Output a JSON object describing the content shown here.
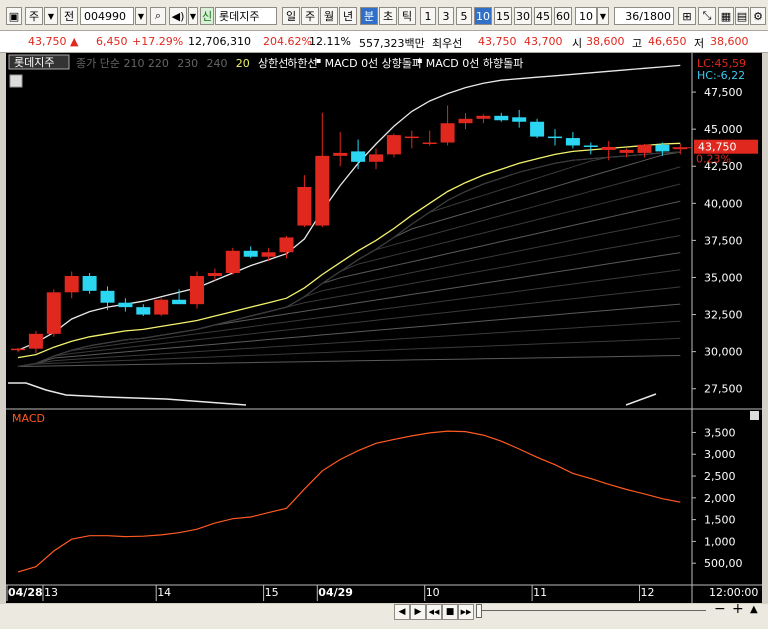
{
  "toolbar": {
    "market": "주",
    "market_arrow": "▼",
    "scope": "전",
    "code": "004990",
    "badge": "신",
    "name": "롯데지주",
    "periods": [
      "일",
      "주",
      "월",
      "년",
      "분",
      "초",
      "틱"
    ],
    "selected_period": "분",
    "intervals": [
      "1",
      "3",
      "5",
      "10",
      "15",
      "30",
      "45",
      "60"
    ],
    "selected_interval": "10",
    "interval_value": "10",
    "count": "36",
    "count_total": "/1800"
  },
  "quote": {
    "price": "43,750",
    "direction": "▲",
    "change": "6,450",
    "change_pct": "+17.29%",
    "volume": "12,706,310",
    "volume_ratio": "204.62%",
    "turnover": "12.11%",
    "amount": "557,323백만",
    "best": "최우선",
    "ask": "43,750",
    "bid": "43,700",
    "open_label": "시",
    "open": "38,600",
    "high_label": "고",
    "high": "46,650",
    "low_label": "저",
    "low": "38,600"
  },
  "colors": {
    "up": "#e0281e",
    "down": "#2bd6f2",
    "ma_yellow": "#f2f26e",
    "ma_white": "#e8e8e8",
    "macd": "#ff5a22",
    "label_red": "#e0281e"
  },
  "chart_data": [
    {
      "type": "candlestick",
      "legend": {
        "stock": "롯데지주",
        "items": [
          "종가 단순 210",
          "220",
          "230",
          "240",
          "20",
          "상한선",
          "하한선",
          "MACD 0선 상향돌파",
          "MACD 0선 하향돌파"
        ]
      },
      "annotations": {
        "lc": "LC:45,59",
        "hc": "HC:-6,22",
        "last_price": "43,750",
        "last_pct": "0.23%"
      },
      "y_ticks": [
        27500,
        30000,
        32500,
        35000,
        37500,
        40000,
        42500,
        45000,
        47500
      ],
      "y_tick_labels": [
        "27,500",
        "30,000",
        "32,500",
        "35,000",
        "37,500",
        "40,000",
        "42,500",
        "45,000",
        "47,500"
      ],
      "ylim": [
        26200,
        50000
      ],
      "x_tick_labels": [
        {
          "index": 0,
          "label": "04/28",
          "bold": true
        },
        {
          "index": 0.5,
          "label": "13",
          "bold": false
        },
        {
          "index": 8,
          "label": "14",
          "bold": false
        },
        {
          "index": 14,
          "label": "15",
          "bold": false
        },
        {
          "index": 17,
          "label": "04/29",
          "bold": true
        },
        {
          "index": 23,
          "label": "10",
          "bold": false
        },
        {
          "index": 29,
          "label": "11",
          "bold": false
        },
        {
          "index": 35,
          "label": "12",
          "bold": false
        }
      ],
      "time_label": "12:00:00",
      "candles": [
        {
          "o": 30100,
          "h": 30250,
          "l": 29950,
          "c": 30200
        },
        {
          "o": 30200,
          "h": 31400,
          "l": 29900,
          "c": 31200
        },
        {
          "o": 31200,
          "h": 34200,
          "l": 31000,
          "c": 34000
        },
        {
          "o": 34000,
          "h": 35400,
          "l": 33600,
          "c": 35100
        },
        {
          "o": 35100,
          "h": 35300,
          "l": 33900,
          "c": 34100
        },
        {
          "o": 34100,
          "h": 34400,
          "l": 32800,
          "c": 33300
        },
        {
          "o": 33300,
          "h": 33600,
          "l": 32700,
          "c": 33000
        },
        {
          "o": 33000,
          "h": 33200,
          "l": 32400,
          "c": 32500
        },
        {
          "o": 32500,
          "h": 33600,
          "l": 32400,
          "c": 33500
        },
        {
          "o": 33500,
          "h": 34200,
          "l": 33300,
          "c": 33200
        },
        {
          "o": 33200,
          "h": 35400,
          "l": 32900,
          "c": 35100
        },
        {
          "o": 35100,
          "h": 35600,
          "l": 34800,
          "c": 35300
        },
        {
          "o": 35300,
          "h": 37000,
          "l": 35200,
          "c": 36800
        },
        {
          "o": 36800,
          "h": 37100,
          "l": 36300,
          "c": 36400
        },
        {
          "o": 36400,
          "h": 37000,
          "l": 36100,
          "c": 36700
        },
        {
          "o": 36700,
          "h": 37800,
          "l": 36300,
          "c": 37700
        },
        {
          "o": 38500,
          "h": 41900,
          "l": 38400,
          "c": 41100
        },
        {
          "o": 38500,
          "h": 46100,
          "l": 38400,
          "c": 43200
        },
        {
          "o": 43200,
          "h": 44800,
          "l": 42500,
          "c": 43400
        },
        {
          "o": 43500,
          "h": 44300,
          "l": 42300,
          "c": 42800
        },
        {
          "o": 42800,
          "h": 43700,
          "l": 42300,
          "c": 43300
        },
        {
          "o": 43300,
          "h": 44700,
          "l": 43100,
          "c": 44600
        },
        {
          "o": 44400,
          "h": 44900,
          "l": 43700,
          "c": 44500
        },
        {
          "o": 44000,
          "h": 44900,
          "l": 43900,
          "c": 44100
        },
        {
          "o": 44100,
          "h": 46600,
          "l": 43900,
          "c": 45400
        },
        {
          "o": 45400,
          "h": 46100,
          "l": 45000,
          "c": 45700
        },
        {
          "o": 45700,
          "h": 46000,
          "l": 45400,
          "c": 45900
        },
        {
          "o": 45900,
          "h": 46100,
          "l": 45500,
          "c": 45600
        },
        {
          "o": 45800,
          "h": 46300,
          "l": 45100,
          "c": 45500
        },
        {
          "o": 45500,
          "h": 45700,
          "l": 44400,
          "c": 44500
        },
        {
          "o": 44500,
          "h": 45000,
          "l": 43900,
          "c": 44400
        },
        {
          "o": 44400,
          "h": 44800,
          "l": 43700,
          "c": 43900
        },
        {
          "o": 43900,
          "h": 44100,
          "l": 43300,
          "c": 43800
        },
        {
          "o": 43600,
          "h": 44200,
          "l": 42900,
          "c": 43800
        },
        {
          "o": 43400,
          "h": 43700,
          "l": 43100,
          "c": 43600
        },
        {
          "o": 43400,
          "h": 44000,
          "l": 43100,
          "c": 43950
        },
        {
          "o": 43950,
          "h": 44100,
          "l": 43200,
          "c": 43500
        },
        {
          "o": 43700,
          "h": 44000,
          "l": 43300,
          "c": 43750
        }
      ],
      "series": [
        {
          "name": "20",
          "color": "#f2f26e",
          "values": [
            29600,
            29800,
            30300,
            30700,
            31000,
            31200,
            31400,
            31500,
            31700,
            31900,
            32100,
            32400,
            32700,
            33000,
            33300,
            33600,
            34300,
            35200,
            36000,
            36800,
            37500,
            38300,
            39200,
            40000,
            40800,
            41400,
            41900,
            42300,
            42700,
            43000,
            43300,
            43500,
            43600,
            43700,
            43800,
            43900,
            44000,
            44050
          ]
        },
        {
          "name": "상한선",
          "color": "#e8e8e8",
          "values": [
            30100,
            30600,
            31300,
            32200,
            32700,
            33000,
            33200,
            33400,
            33700,
            34000,
            34300,
            34800,
            35300,
            35800,
            36200,
            36600,
            37600,
            39500,
            41200,
            42700,
            44000,
            45200,
            46200,
            46900,
            47400,
            47800,
            48100,
            48300,
            48400,
            48500,
            48600,
            48700,
            48800,
            48900,
            49000,
            49100,
            49200,
            49300
          ]
        }
      ]
    },
    {
      "type": "line",
      "title": "MACD",
      "y_ticks": [
        500,
        1000,
        1500,
        2000,
        2500,
        3000,
        3500
      ],
      "y_tick_labels": [
        "500,00",
        "1,000",
        "1,500",
        "2,000",
        "2,500",
        "3,000",
        "3,500"
      ],
      "ylim": [
        0,
        3900
      ],
      "series": [
        {
          "name": "MACD",
          "color": "#ff5a22",
          "values": [
            300,
            420,
            780,
            1050,
            1130,
            1130,
            1110,
            1120,
            1150,
            1200,
            1280,
            1420,
            1520,
            1560,
            1660,
            1760,
            2200,
            2620,
            2880,
            3080,
            3250,
            3340,
            3420,
            3490,
            3530,
            3520,
            3440,
            3300,
            3120,
            2930,
            2760,
            2560,
            2440,
            2310,
            2190,
            2090,
            1980,
            1900
          ]
        }
      ]
    }
  ],
  "bottom": {
    "nav": [
      "◀",
      "▶",
      "◀◀",
      "■",
      "▶▶"
    ],
    "zoom_out": "−",
    "zoom_in": "+",
    "collapse": "▲"
  }
}
